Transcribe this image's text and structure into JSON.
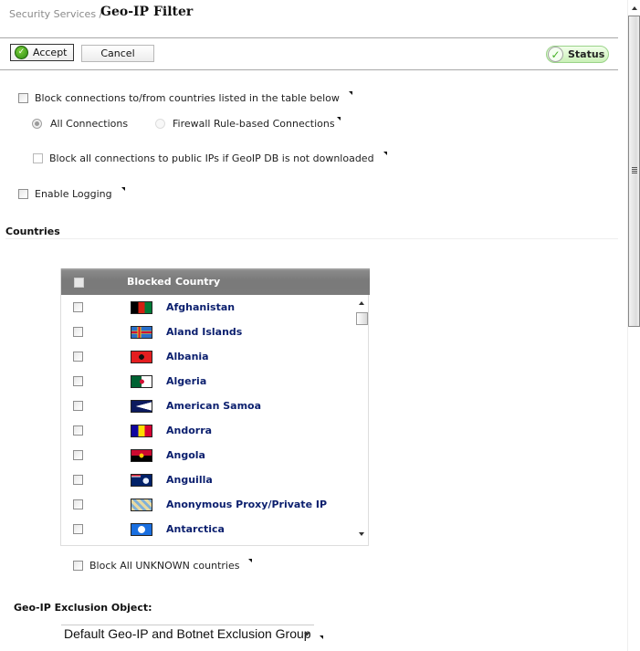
{
  "header": {
    "breadcrumb": "Security Services /",
    "title": "Geo-IP Filter"
  },
  "toolbar": {
    "accept_label": "Accept",
    "cancel_label": "Cancel",
    "status_label": "Status"
  },
  "settings": {
    "block_connections": {
      "label": "Block connections to/from countries listed in the table below",
      "checked": false
    },
    "connection_mode": {
      "options": [
        {
          "label": "All Connections",
          "selected": true,
          "enabled": false
        },
        {
          "label": "Firewall Rule-based Connections",
          "selected": false,
          "enabled": false
        }
      ]
    },
    "block_public_ips": {
      "label": "Block all connections to public IPs if GeoIP DB is not downloaded",
      "checked": false
    },
    "enable_logging": {
      "label": "Enable Logging",
      "checked": false
    }
  },
  "countries": {
    "section_title": "Countries",
    "columns": [
      "Blocked",
      "Country"
    ],
    "rows": [
      {
        "name": "Afghanistan",
        "blocked": false,
        "flag": "afghanistan-flag"
      },
      {
        "name": "Aland Islands",
        "blocked": false,
        "flag": "aland-islands-flag"
      },
      {
        "name": "Albania",
        "blocked": false,
        "flag": "albania-flag"
      },
      {
        "name": "Algeria",
        "blocked": false,
        "flag": "algeria-flag"
      },
      {
        "name": "American Samoa",
        "blocked": false,
        "flag": "american-samoa-flag"
      },
      {
        "name": "Andorra",
        "blocked": false,
        "flag": "andorra-flag"
      },
      {
        "name": "Angola",
        "blocked": false,
        "flag": "angola-flag"
      },
      {
        "name": "Anguilla",
        "blocked": false,
        "flag": "anguilla-flag"
      },
      {
        "name": "Anonymous Proxy/Private IP",
        "blocked": false,
        "flag": "anonymous-proxy-flag"
      },
      {
        "name": "Antarctica",
        "blocked": false,
        "flag": "antarctica-flag"
      }
    ],
    "block_unknown": {
      "label": "Block All UNKNOWN countries",
      "checked": false
    }
  },
  "exclusion": {
    "label": "Geo-IP Exclusion Object:",
    "selected": "Default Geo-IP and Botnet Exclusion Group"
  }
}
